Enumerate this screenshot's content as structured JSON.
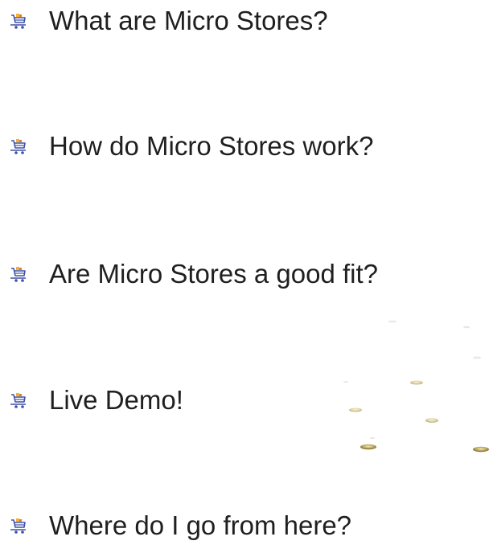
{
  "slide": {
    "bullets": [
      {
        "icon": "shopping-cart-icon",
        "text": "What are Micro Stores?"
      },
      {
        "icon": "shopping-cart-icon",
        "text": "How do Micro Stores work?"
      },
      {
        "icon": "shopping-cart-icon",
        "text": "Are Micro Stores a good fit?"
      },
      {
        "icon": "shopping-cart-icon",
        "text": "Live Demo!"
      },
      {
        "icon": "shopping-cart-icon",
        "text": "Where do I go from here?"
      }
    ],
    "decoration": {
      "icon": "scattered-coins-image"
    },
    "colors": {
      "text": "#1f1f1f",
      "cart_basket": "#3f51a8",
      "cart_goods": "#f2b134",
      "background": "#ffffff"
    }
  }
}
